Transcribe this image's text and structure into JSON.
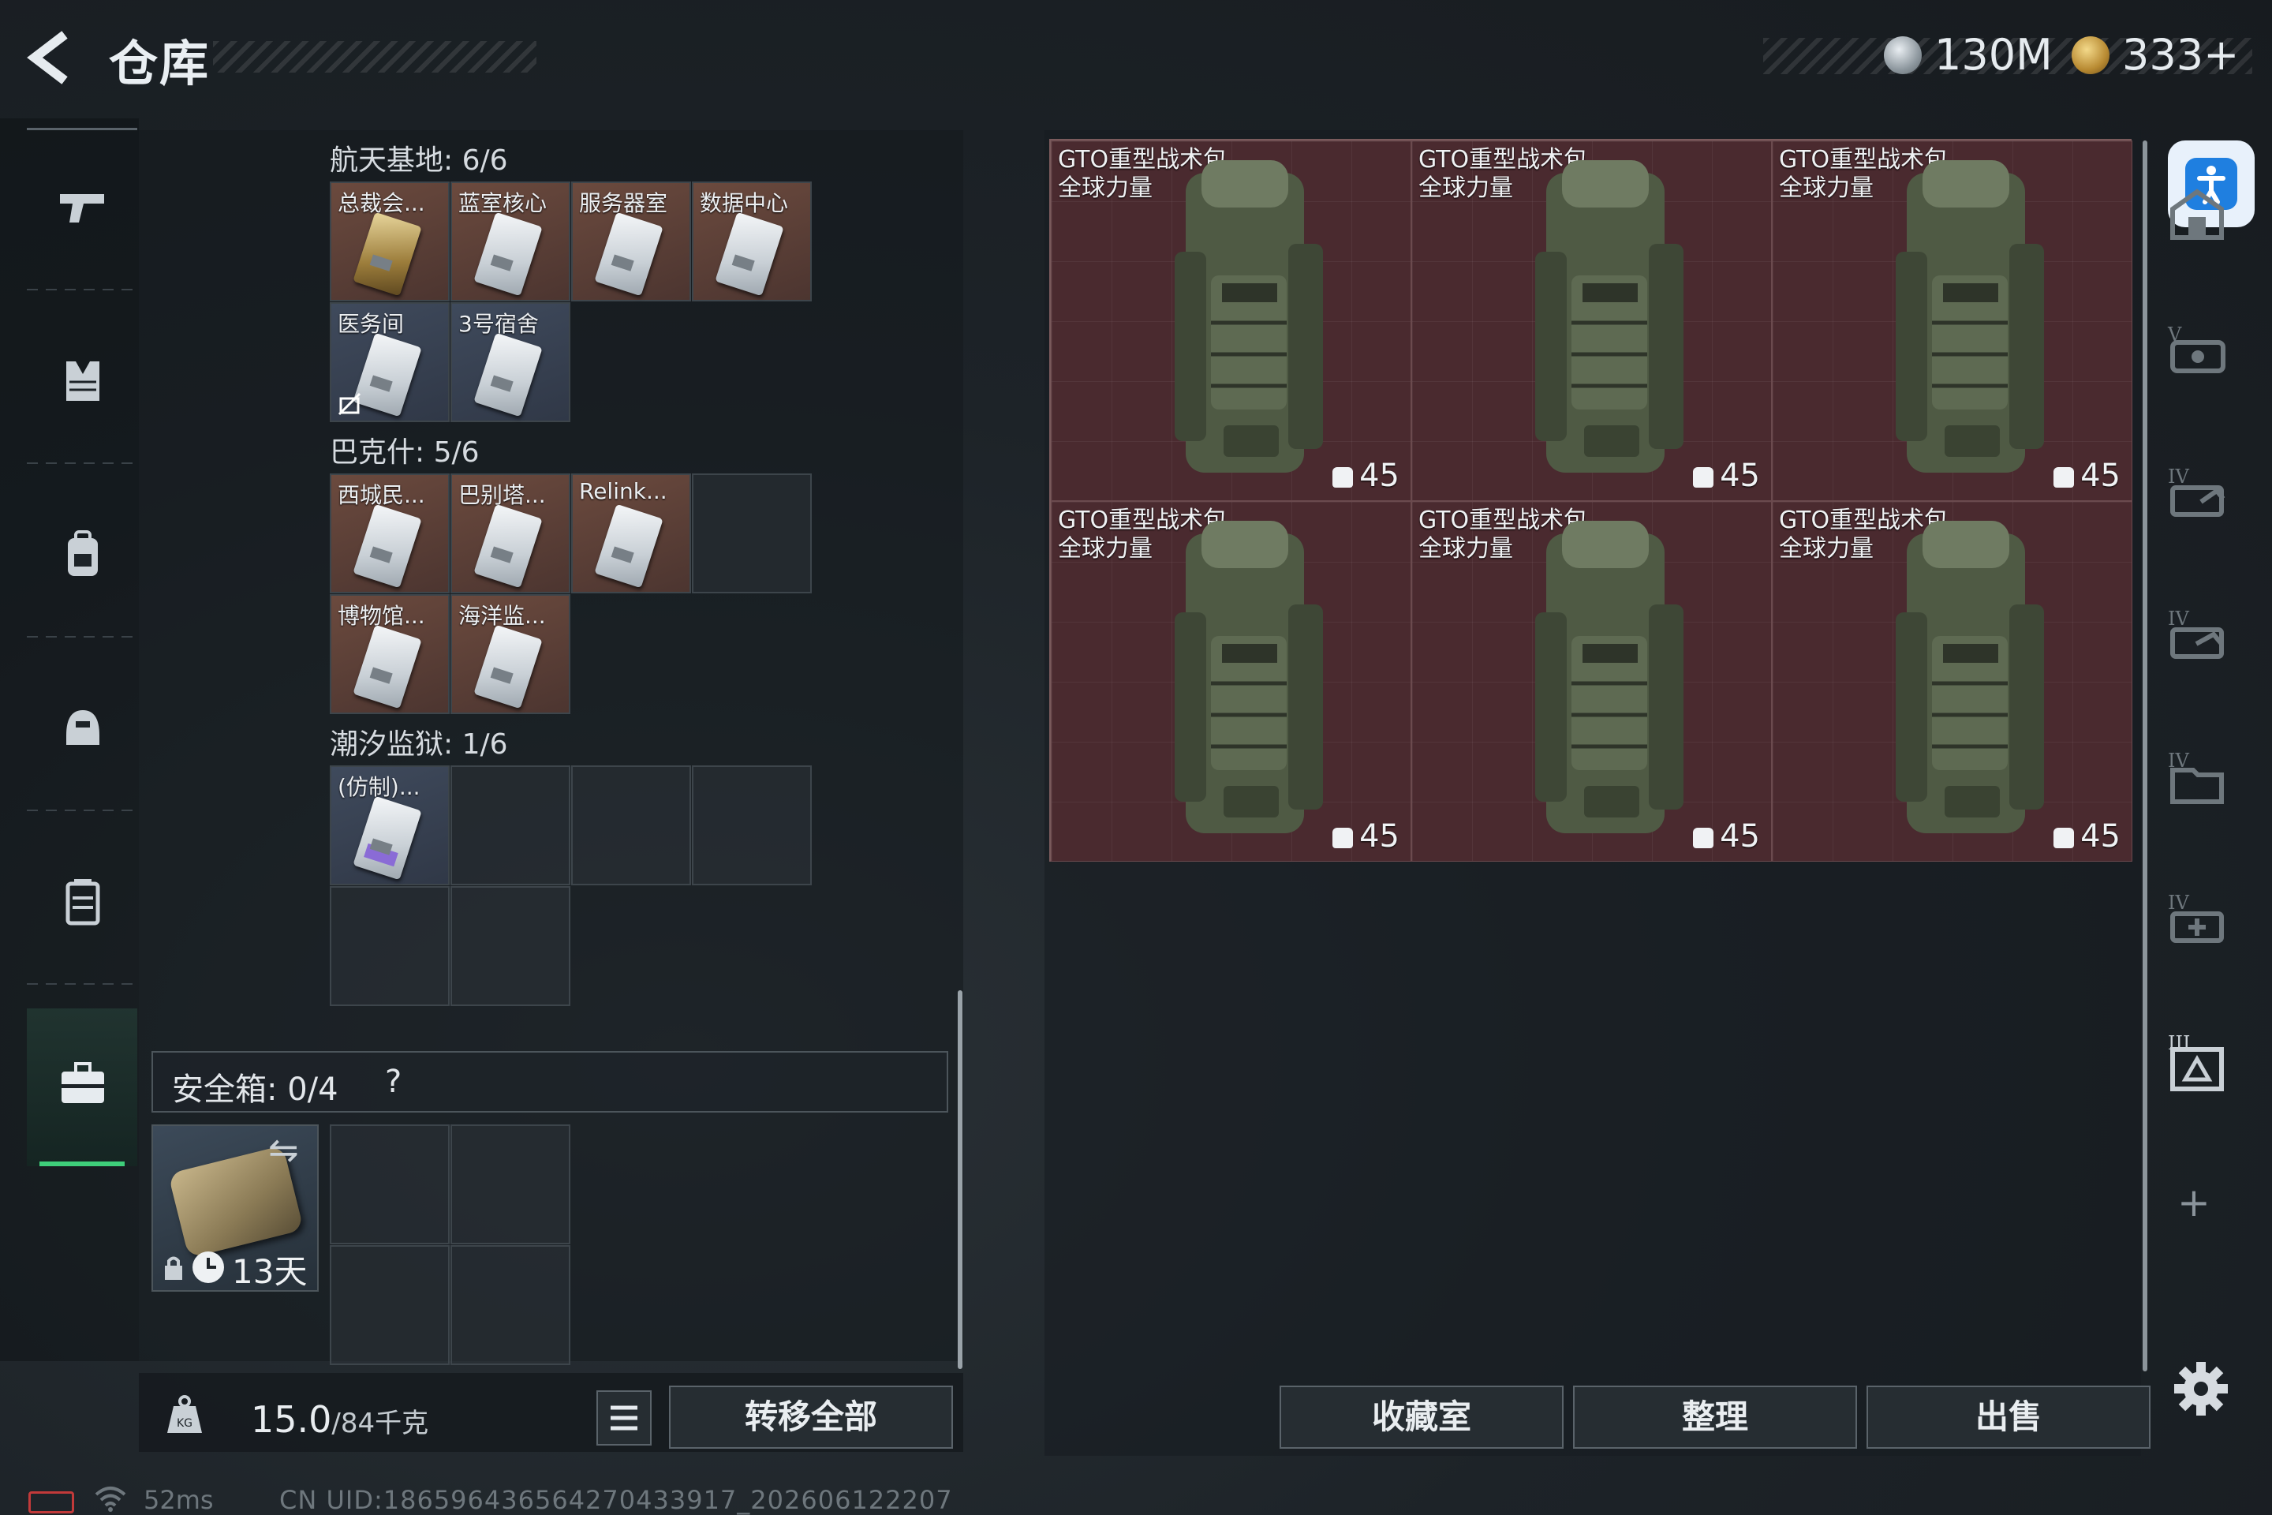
{
  "header": {
    "title": "仓库",
    "currency_silver": "130M",
    "currency_gold": "333+"
  },
  "nav": {
    "icons": [
      "pistol-icon",
      "vest-icon",
      "backpack-icon",
      "helmet-icon",
      "container-icon",
      "keycard-case-icon"
    ],
    "active_index": 5
  },
  "groups": [
    {
      "label": "航天基地: 6/6",
      "cards": [
        {
          "name": "总裁会...",
          "color": "gold"
        },
        {
          "name": "蓝室核心",
          "color": "white"
        },
        {
          "name": "服务器室",
          "color": "white"
        },
        {
          "name": "数据中心",
          "color": "white"
        },
        {
          "name": "医务间",
          "color": "white"
        },
        {
          "name": "3号宿舍",
          "color": "white"
        }
      ]
    },
    {
      "label": "巴克什: 5/6",
      "cards": [
        {
          "name": "西城民...",
          "color": "white"
        },
        {
          "name": "巴别塔...",
          "color": "white"
        },
        {
          "name": "Relink...",
          "color": "white"
        },
        {
          "name": "博物馆...",
          "color": "white"
        },
        {
          "name": "海洋监...",
          "color": "white"
        }
      ]
    },
    {
      "label": "潮汐监狱: 1/6",
      "cards": [
        {
          "name": "(仿制)...",
          "color": "purple"
        }
      ]
    }
  ],
  "safe_box": {
    "label": "安全箱: 0/4",
    "help": "?",
    "remaining": "13天"
  },
  "weight": {
    "current": "15.0",
    "max": "/84千克"
  },
  "buttons": {
    "transfer_all": "转移全部",
    "collection_room": "收藏室",
    "organize": "整理",
    "sell": "出售"
  },
  "items": [
    {
      "name": "GTO重型战术包",
      "subtitle": "全球力量",
      "count": "45"
    },
    {
      "name": "GTO重型战术包",
      "subtitle": "全球力量",
      "count": "45"
    },
    {
      "name": "GTO重型战术包",
      "subtitle": "全球力量",
      "count": "45"
    },
    {
      "name": "GTO重型战术包",
      "subtitle": "全球力量",
      "count": "45"
    },
    {
      "name": "GTO重型战术包",
      "subtitle": "全球力量",
      "count": "45"
    },
    {
      "name": "GTO重型战术包",
      "subtitle": "全球力量",
      "count": "45"
    }
  ],
  "right_toolbar": [
    "storage-icon",
    "gun-case-icon",
    "ammo-case-icon",
    "weapon-case-icon",
    "file-case-icon",
    "medical-case-icon",
    "iii-case-icon"
  ],
  "status": {
    "ping": "52ms",
    "uid": "CN UID:18659643656427043391​7_202606122207"
  },
  "colors": {
    "accent_green": "#3ecf7a",
    "item_bg": "#4a2a2f",
    "card_bg": "#6b4a3e"
  }
}
